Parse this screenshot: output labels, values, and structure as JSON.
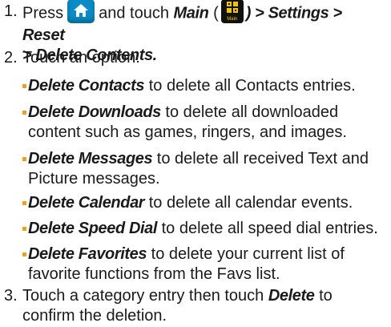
{
  "step1": {
    "number": "1.",
    "pre": "Press",
    "mid": "and touch",
    "main_label": "Main",
    "open_paren": "(",
    "main_icon_caption": "Main",
    "close_paren_path": ") > Settings > Reset",
    "line2": "> Delete Contents."
  },
  "step2": {
    "number": "2.",
    "text": "Touch an option:"
  },
  "options": [
    {
      "em": "Delete Contacts",
      "rest": " to delete all Contacts entries."
    },
    {
      "em": "Delete Downloads",
      "rest": " to delete all downloaded content such as games, ringers, and images."
    },
    {
      "em": "Delete Messages",
      "rest": " to delete all received Text and Picture messages."
    },
    {
      "em": "Delete Calendar",
      "rest": " to delete all calendar events."
    },
    {
      "em": "Delete Speed Dial",
      "rest": " to delete all speed dial entries."
    },
    {
      "em": "Delete Favorites",
      "rest": " to delete your current list of favorite functions from the Favs list."
    }
  ],
  "step3": {
    "number": "3.",
    "pre": "Touch a category entry then touch",
    "em": "Delete",
    "post": "to confirm the deletion."
  },
  "colors": {
    "bullet": "#f0a020",
    "home_icon_bg": "#0b8bc6",
    "main_icon_bg": "#111111",
    "main_icon_glyph": "#f5c400"
  },
  "icons": {
    "home": "home-icon",
    "main": "main-menu-icon"
  }
}
